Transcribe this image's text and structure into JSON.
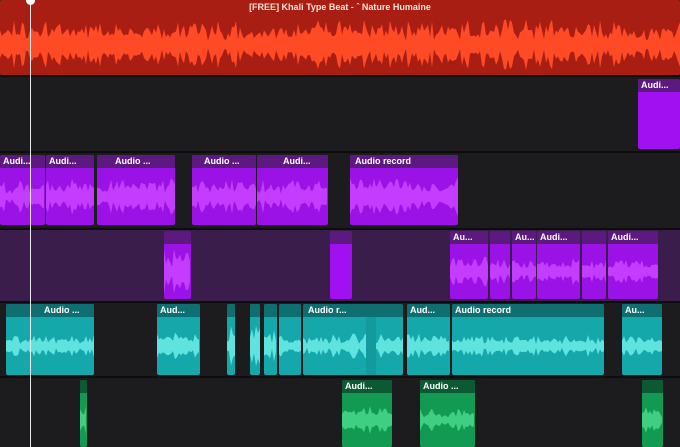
{
  "colors": {
    "red": "#e8341c",
    "red_dark": "#b22214",
    "magenta": "#a010f0",
    "magenta_dark": "#5a1a7a",
    "cyan": "#1ab8b8",
    "cyan_dark": "#0f6e70",
    "green": "#149a55",
    "green_dark": "#0b5a33"
  },
  "tracks": [
    {
      "name": "track-red",
      "color": "red",
      "clips": [
        {
          "title": "[FREE] Khali Type Beat - ˆ Nature Humaine"
        }
      ]
    },
    {
      "name": "track-magenta-1",
      "color": "magenta",
      "clips": [
        {
          "title": "Audi..."
        }
      ]
    },
    {
      "name": "track-magenta-2",
      "color": "magenta",
      "clips": [
        {
          "title": "Audi..."
        },
        {
          "title": "Audi..."
        },
        {
          "title": "Audio ..."
        },
        {
          "title": "Audio ..."
        },
        {
          "title": "Audi..."
        },
        {
          "title": "Audio record"
        }
      ]
    },
    {
      "name": "track-purple",
      "color": "magenta",
      "clips": [
        {
          "title": ""
        },
        {
          "title": ""
        },
        {
          "title": "Au..."
        },
        {
          "title": ""
        },
        {
          "title": "Au..."
        },
        {
          "title": "Audi..."
        },
        {
          "title": ""
        },
        {
          "title": "Audi..."
        }
      ]
    },
    {
      "name": "track-cyan",
      "color": "cyan",
      "clips": [
        {
          "title": "Audio ..."
        },
        {
          "title": "Aud..."
        },
        {
          "title": ""
        },
        {
          "title": ""
        },
        {
          "title": ""
        },
        {
          "title": ""
        },
        {
          "title": "Audio r..."
        },
        {
          "title": ""
        },
        {
          "title": "Aud..."
        },
        {
          "title": "Audio record"
        },
        {
          "title": "Au..."
        }
      ]
    },
    {
      "name": "track-green",
      "color": "green",
      "clips": [
        {
          "title": ""
        },
        {
          "title": "Audi..."
        },
        {
          "title": "Audio ..."
        },
        {
          "title": ""
        }
      ]
    }
  ]
}
